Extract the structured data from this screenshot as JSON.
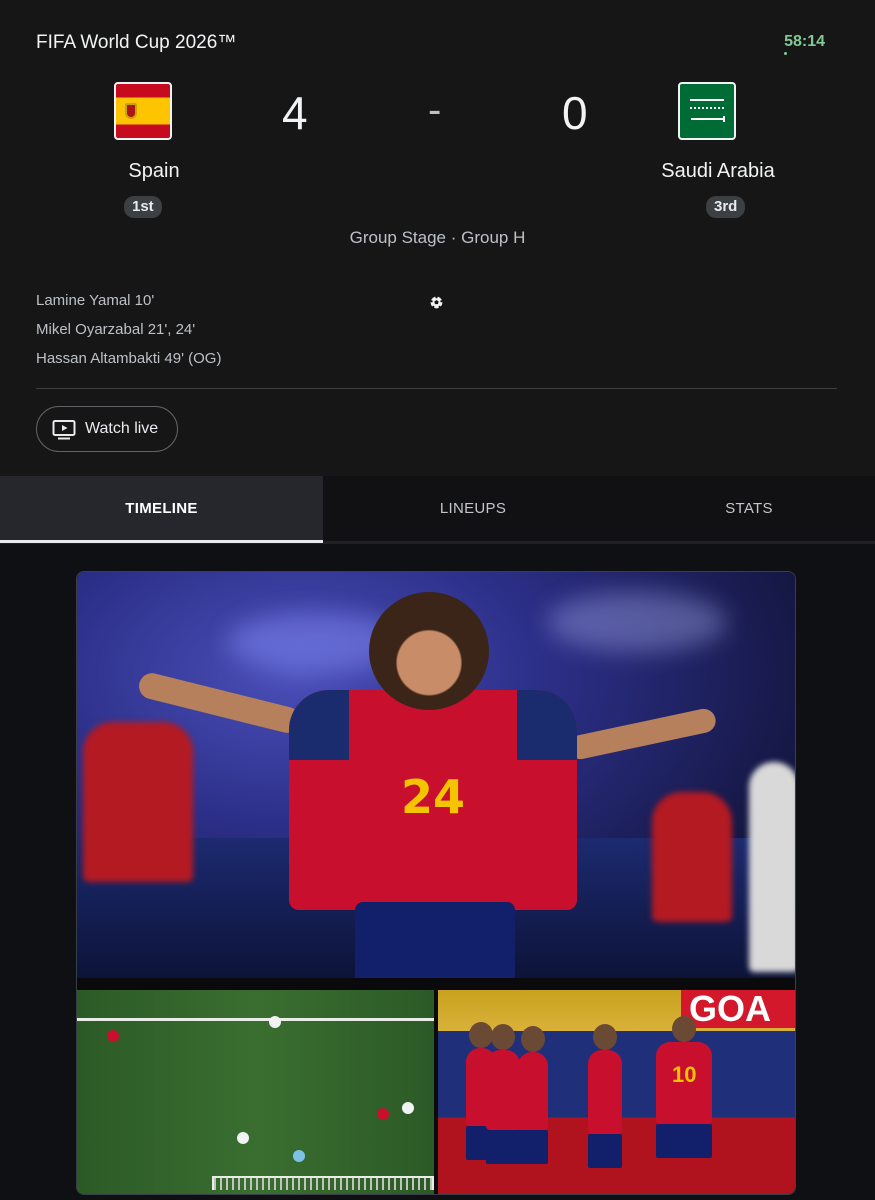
{
  "header": {
    "competition": "FIFA World Cup 2026™",
    "clock": "58:14"
  },
  "match": {
    "home": {
      "name": "Spain",
      "score": "4",
      "rank": "1st",
      "flag": "spain-flag-icon"
    },
    "separator": "-",
    "away": {
      "name": "Saudi Arabia",
      "score": "0",
      "rank": "3rd",
      "flag": "saudi-arabia-flag-icon"
    },
    "stage": "Group Stage · Group H"
  },
  "scorers": [
    "Lamine Yamal 10'",
    "Mikel Oyarzabal 21', 24'",
    "Hassan Altambakti 49' (OG)"
  ],
  "actions": {
    "watch_live": "Watch live"
  },
  "tabs": [
    {
      "label": "TIMELINE",
      "selected": true
    },
    {
      "label": "LINEUPS",
      "selected": false
    },
    {
      "label": "STATS",
      "selected": false
    }
  ],
  "gallery": {
    "hero_shirt_number": "24",
    "celebration_shirt_number": "10",
    "celebration_ad_text": "GOA"
  },
  "colors": {
    "live": "#81c995",
    "background": "#161617",
    "spain_red": "#c8102e",
    "spain_yellow": "#f5c400"
  }
}
